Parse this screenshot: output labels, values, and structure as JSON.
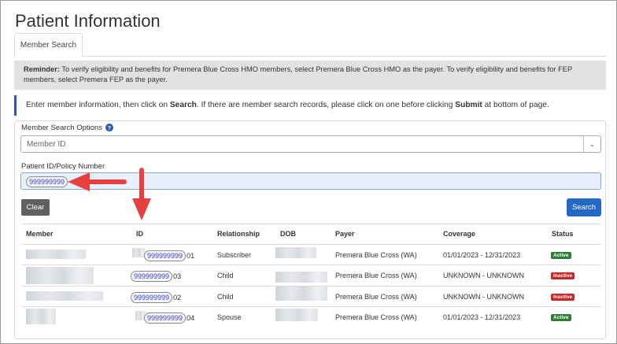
{
  "page": {
    "title": "Patient Information"
  },
  "tabs": [
    {
      "label": "Member Search"
    }
  ],
  "reminder": {
    "label": "Reminder:",
    "text": " To verify eligibility and benefits for Premera Blue Cross HMO members, select Premera Blue Cross HMO as the payer. To verify eligibility and benefits for FEP members, select Premera FEP as the payer."
  },
  "instructions": {
    "part1": "Enter member information, then click on ",
    "bold1": "Search",
    "part2": ". If there are member search records, please click on one before clicking ",
    "bold2": "Submit",
    "part3": " at bottom of page."
  },
  "form": {
    "options_label": "Member Search Options",
    "options_value": "Member ID",
    "policy_label": "Patient ID/Policy Number",
    "policy_value": "999999999",
    "clear_label": "Clear",
    "search_label": "Search"
  },
  "table": {
    "headers": [
      "Member",
      "ID",
      "Relationship",
      "DOB",
      "Payer",
      "Coverage",
      "Status"
    ],
    "rows": [
      {
        "id": "999999999",
        "suffix": "01",
        "relationship": "Subscriber",
        "payer": "Premera Blue Cross (WA)",
        "coverage": "01/01/2023 - 12/31/2023",
        "status": "Active"
      },
      {
        "id": "999999999",
        "suffix": "03",
        "relationship": "Child",
        "payer": "Premera Blue Cross (WA)",
        "coverage": "UNKNOWN - UNKNOWN",
        "status": "Inactive"
      },
      {
        "id": "999999999",
        "suffix": "02",
        "relationship": "Child",
        "payer": "Premera Blue Cross (WA)",
        "coverage": "UNKNOWN - UNKNOWN",
        "status": "Inactive"
      },
      {
        "id": "999999999",
        "suffix": "04",
        "relationship": "Spouse",
        "payer": "Premera Blue Cross (WA)",
        "coverage": "01/01/2023 - 12/31/2023",
        "status": "Active"
      }
    ]
  },
  "icons": {
    "help": "help-circle-icon",
    "dropdown": "chevron-down-icon",
    "arrows": "red-annotation-arrow"
  },
  "colors": {
    "primary": "#2368c4",
    "active": "#2e7d32",
    "inactive": "#c62828",
    "annotation": "#e8403e"
  }
}
